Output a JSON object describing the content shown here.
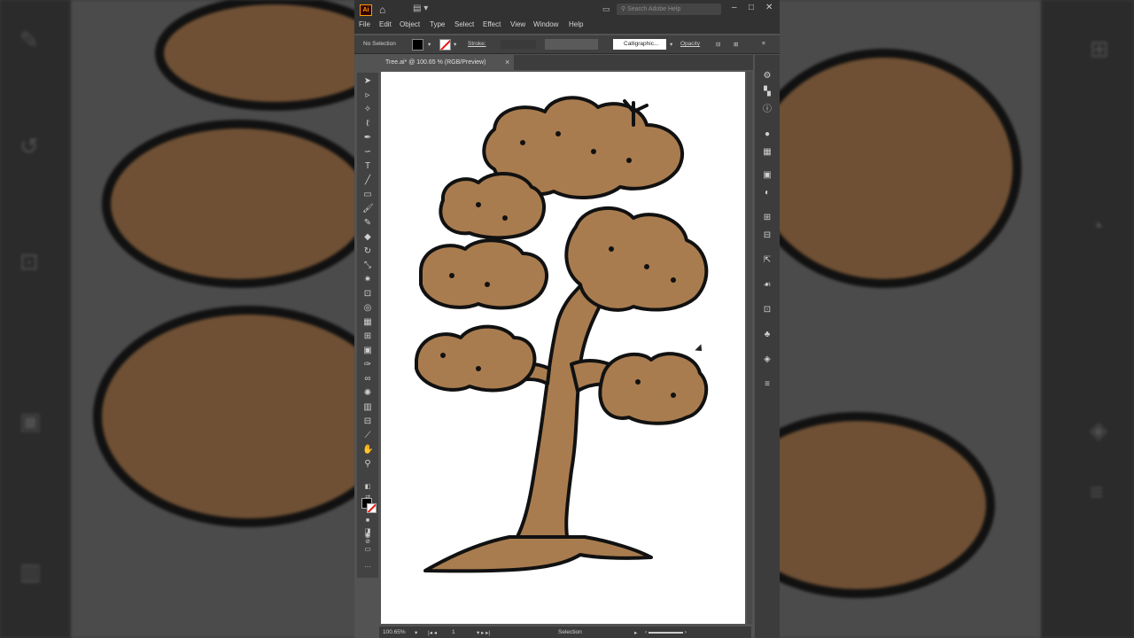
{
  "colors": {
    "app_bg": "#535353",
    "chrome": "#323232",
    "artboard": "#ffffff",
    "foliage": "#a97c4f",
    "outline": "#111111",
    "logo_orange": "#ff9a00"
  },
  "titlebar": {
    "app_logo": "Ai",
    "search_placeholder": "Search Adobe Help",
    "icons": [
      "home-icon",
      "workspace-icon",
      "minimize-icon",
      "maximize-icon",
      "close-icon"
    ]
  },
  "menubar": {
    "items": [
      "File",
      "Edit",
      "Object",
      "Type",
      "Select",
      "Effect",
      "View",
      "Window",
      "Help"
    ]
  },
  "controlbar": {
    "selection_status": "No Selection",
    "stroke_label": "Stroke:",
    "brush_value": "Calligraphic...",
    "opacity_label": "Opacity"
  },
  "document": {
    "tab_title": "Tree.ai* @ 100.65 % (RGB/Preview)"
  },
  "statusbar": {
    "zoom": "100.65%",
    "artboard_number": "1",
    "tool_name": "Selection"
  }
}
